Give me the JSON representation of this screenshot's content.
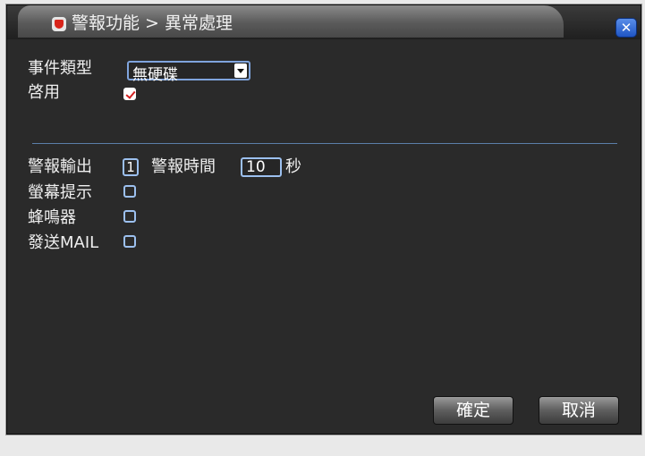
{
  "title": "警報功能 > 異常處理",
  "form": {
    "event_type_label": "事件類型",
    "event_type_value": "無硬碟",
    "enable_label": "啓用",
    "enable_checked": true,
    "alarm_output_label": "警報輸出",
    "alarm_output_channel": "1",
    "alarm_time_label": "警報時間",
    "alarm_time_value": "10",
    "alarm_time_unit": "秒",
    "screen_prompt_label": "螢幕提示",
    "screen_prompt_checked": false,
    "buzzer_label": "蜂鳴器",
    "buzzer_checked": false,
    "send_mail_label": "發送MAIL",
    "send_mail_checked": false
  },
  "buttons": {
    "ok_label": "確定",
    "cancel_label": "取消"
  },
  "icons": {
    "title": "shield-icon",
    "close": "close-icon"
  },
  "colors": {
    "accent_border": "#9cc0ef",
    "check_mark": "#d21f1f",
    "close_button": "#2a66d6"
  }
}
